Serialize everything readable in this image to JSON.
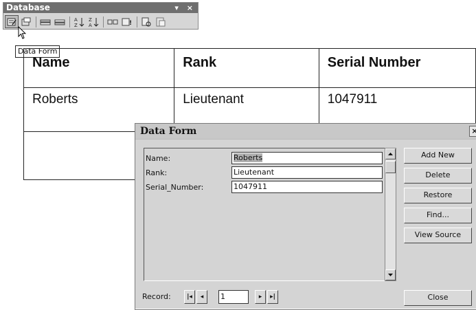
{
  "toolbar": {
    "title": "Database",
    "title_controls": "▾ ×",
    "buttons": [
      {
        "name": "data-form-icon",
        "pressed": true
      },
      {
        "name": "manage-fields-icon"
      },
      {
        "name": "add-record-icon"
      },
      {
        "name": "delete-record-icon"
      },
      {
        "name": "sort-ascending-icon"
      },
      {
        "name": "sort-descending-icon"
      },
      {
        "name": "insert-database-icon"
      },
      {
        "name": "update-field-icon"
      },
      {
        "name": "find-record-icon"
      },
      {
        "name": "mail-merge-main-document-icon"
      }
    ],
    "tooltip": "Data Form"
  },
  "table": {
    "headers": [
      "Name",
      "Rank",
      "Serial Number"
    ],
    "rows": [
      [
        "Roberts",
        "Lieutenant",
        "1047911"
      ],
      [
        "",
        "",
        ""
      ]
    ]
  },
  "dialog": {
    "title": "Data Form",
    "close_glyph": "×",
    "fields": [
      {
        "label": "Name:",
        "value": "Roberts"
      },
      {
        "label": "Rank:",
        "value": "Lieutenant"
      },
      {
        "label": "Serial_Number:",
        "value": "1047911"
      }
    ],
    "buttons": {
      "add_new": "Add New",
      "delete": "Delete",
      "restore": "Restore",
      "find": "Find...",
      "view_source": "View Source",
      "close": "Close"
    },
    "record_label": "Record:",
    "record_value": "1"
  }
}
